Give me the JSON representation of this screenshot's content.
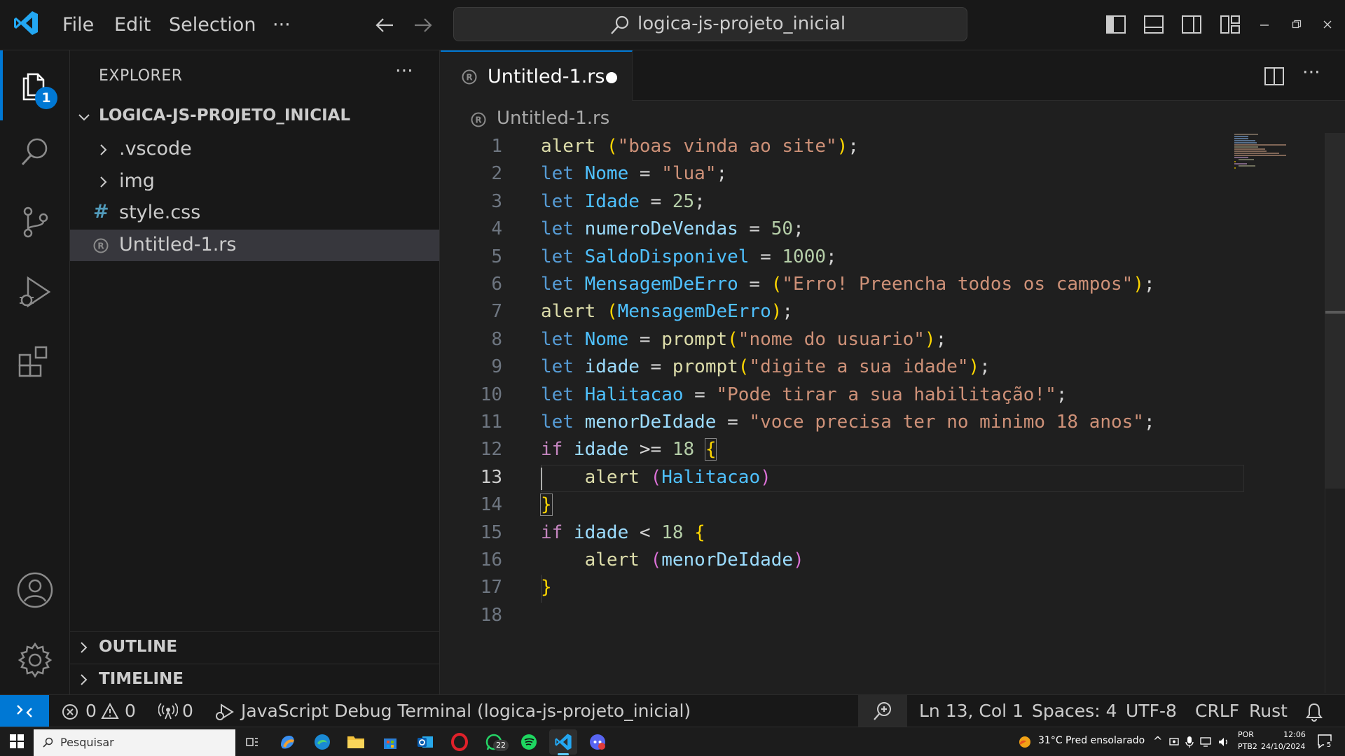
{
  "titlebar": {
    "menus": [
      "File",
      "Edit",
      "Selection",
      "···"
    ],
    "search_text": "logica-js-projeto_inicial",
    "window_controls": [
      "layout-toggle-sidebar-icon",
      "layout-toggle-panel-icon",
      "layout-toggle-secondary-icon",
      "customize-layout-icon",
      "minimize-icon",
      "restore-icon",
      "close-icon"
    ]
  },
  "activitybar": {
    "explorer_badge": "1",
    "items": [
      "files-icon",
      "search-icon",
      "source-control-icon",
      "run-debug-icon",
      "extensions-icon",
      "accounts-icon",
      "settings-gear-icon"
    ]
  },
  "sidebar": {
    "title": "EXPLORER",
    "more": "···",
    "project": "LOGICA-JS-PROJETO_INICIAL",
    "tree": [
      {
        "label": ".vscode",
        "kind": "folder"
      },
      {
        "label": "img",
        "kind": "folder"
      },
      {
        "label": "style.css",
        "kind": "css"
      },
      {
        "label": "Untitled-1.rs",
        "kind": "rust"
      }
    ],
    "outline": "OUTLINE",
    "timeline": "TIMELINE"
  },
  "editor": {
    "tab_label": "Untitled-1.rs",
    "breadcrumb": "Untitled-1.rs",
    "line_numbers": [
      "1",
      "2",
      "3",
      "4",
      "5",
      "6",
      "7",
      "8",
      "9",
      "10",
      "11",
      "12",
      "13",
      "14",
      "15",
      "16",
      "17",
      "18"
    ],
    "active_line": "13",
    "code": {
      "l1": {
        "a": "alert",
        "b": " ",
        "c": "(",
        "d": "\"boas vinda ao site\"",
        "e": ")",
        "f": ";"
      },
      "l2": {
        "a": "let",
        "b": " Nome",
        "c": " = ",
        "d": "\"lua\"",
        "e": ";"
      },
      "l3": {
        "a": "let",
        "b": " Idade",
        "c": " = ",
        "d": "25",
        "e": ";"
      },
      "l4": {
        "a": "let",
        "b": " numeroDeVendas",
        "c": " = ",
        "d": "50",
        "e": ";"
      },
      "l5": {
        "a": "let",
        "b": " SaldoDisponivel",
        "c": " = ",
        "d": "1000",
        "e": ";"
      },
      "l6": {
        "a": "let",
        "b": " MensagemDeErro",
        "c": " = ",
        "d": "(",
        "e": "\"Erro! Preencha todos os campos\"",
        "f": ")",
        "g": ";"
      },
      "l7": {
        "a": "alert",
        "b": " ",
        "c": "(",
        "d": "MensagemDeErro",
        "e": ")",
        "f": ";"
      },
      "l8": {
        "a": "let",
        "b": " Nome",
        "c": " = ",
        "d": "prompt",
        "e": "(",
        "f": "\"nome do usuario\"",
        "g": ")",
        "h": ";"
      },
      "l9": {
        "a": "let",
        "b": " idade",
        "c": " = ",
        "d": "prompt",
        "e": "(",
        "f": "\"digite a sua idade\"",
        "g": ")",
        "h": ";"
      },
      "l10": {
        "a": "let",
        "b": " Halitacao",
        "c": " = ",
        "d": "\"Pode tirar a sua habilitação!\"",
        "e": ";"
      },
      "l11": {
        "a": "let",
        "b": " menorDeIdade",
        "c": " = ",
        "d": "\"voce precisa ter no minimo 18 anos\"",
        "e": ";"
      },
      "l12": {
        "a": "if",
        "b": " idade",
        "c": " >= ",
        "d": "18",
        "e": " ",
        "f": "{"
      },
      "l13": {
        "a": "    ",
        "b": "alert",
        "c": " ",
        "d": "(",
        "e": "Halitacao",
        "f": ")"
      },
      "l14": {
        "a": "}"
      },
      "l15": {
        "a": "if",
        "b": " idade",
        "c": " < ",
        "d": "18",
        "e": " ",
        "f": "{"
      },
      "l16": {
        "a": "    ",
        "b": "alert",
        "c": " ",
        "d": "(",
        "e": "menorDeIdade",
        "f": ")"
      },
      "l17": {
        "a": "}"
      },
      "l18": {
        "a": ""
      }
    }
  },
  "statusbar": {
    "errors": "0",
    "warnings": "0",
    "ports": "0",
    "debug_terminal": "JavaScript Debug Terminal (logica-js-projeto_inicial)",
    "position": "Ln 13, Col 1",
    "spaces": "Spaces: 4",
    "encoding": "UTF-8",
    "eol": "CRLF",
    "language": "Rust"
  },
  "taskbar": {
    "search_placeholder": "Pesquisar",
    "whatsapp_badge": "22",
    "weather": "31°C  Pred ensolarado",
    "lang_line1": "POR",
    "lang_line2": "PTB2",
    "time": "12:06",
    "date": "24/10/2024",
    "notif_count": "5"
  },
  "colors": {
    "accent": "#0078d4",
    "keyword": "#569cd6",
    "string": "#ce9178",
    "number": "#b5cea8",
    "variable": "#9cdcfe",
    "function": "#dcdcaa"
  }
}
